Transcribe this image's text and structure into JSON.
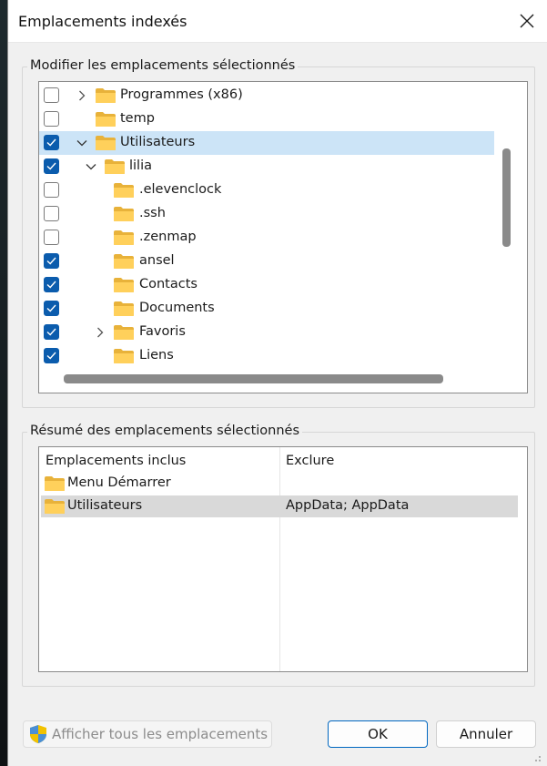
{
  "window": {
    "title": "Emplacements indexés"
  },
  "modify_group": {
    "label": "Modifier les emplacements sélectionnés",
    "items": [
      {
        "label": "Programmes (x86)",
        "checked": false,
        "chevron": "right",
        "level": 0
      },
      {
        "label": "temp",
        "checked": false,
        "chevron": "",
        "level": 0
      },
      {
        "label": "Utilisateurs",
        "checked": true,
        "chevron": "down",
        "level": 0,
        "selected": true
      },
      {
        "label": "lilia",
        "checked": true,
        "chevron": "down",
        "level": 1
      },
      {
        "label": ".elevenclock",
        "checked": false,
        "chevron": "",
        "level": 2
      },
      {
        "label": ".ssh",
        "checked": false,
        "chevron": "",
        "level": 2
      },
      {
        "label": ".zenmap",
        "checked": false,
        "chevron": "",
        "level": 2
      },
      {
        "label": "ansel",
        "checked": true,
        "chevron": "",
        "level": 2
      },
      {
        "label": "Contacts",
        "checked": true,
        "chevron": "",
        "level": 2
      },
      {
        "label": "Documents",
        "checked": true,
        "chevron": "",
        "level": 2
      },
      {
        "label": "Favoris",
        "checked": true,
        "chevron": "right",
        "level": 2
      },
      {
        "label": "Liens",
        "checked": true,
        "chevron": "",
        "level": 2
      }
    ]
  },
  "summary_group": {
    "label": "Résumé des emplacements sélectionnés",
    "columns": [
      "Emplacements inclus",
      "Exclure"
    ],
    "rows": [
      {
        "included": "Menu Démarrer",
        "exclude": ""
      },
      {
        "included": "Utilisateurs",
        "exclude": "AppData; AppData",
        "selected": true
      }
    ]
  },
  "buttons": {
    "show_all": "Afficher tous les emplacements",
    "ok": "OK",
    "cancel": "Annuler"
  },
  "icons": {
    "close": "close-icon",
    "folder": "folder-icon",
    "shield": "uac-shield-icon",
    "checkmark": "checkmark-icon",
    "chevron_right": "chevron-right-icon",
    "chevron_down": "chevron-down-icon"
  },
  "colors": {
    "checkbox_checked": "#0b5cad",
    "selection": "#cce4f7",
    "primary_border": "#0067c0"
  }
}
